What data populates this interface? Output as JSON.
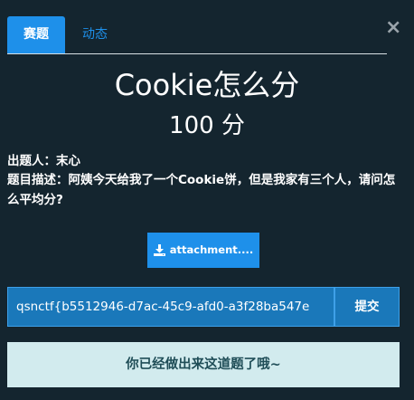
{
  "tabs": [
    {
      "label": "赛题",
      "active": true
    },
    {
      "label": "动态",
      "active": false
    }
  ],
  "close_icon": "close-icon",
  "challenge": {
    "title": "Cookie怎么分",
    "score": "100 分",
    "author_label": "出题人：",
    "author_name": "末心",
    "description_label": "题目描述：",
    "description": "阿姨今天给我了一个Cookie饼，但是我家有三个人，请问怎么平均分?"
  },
  "attachment": {
    "icon": "download-icon",
    "label": "attachment...."
  },
  "flag": {
    "value": "qsnctf{b5512946-d7ac-45c9-afd0-a3f28ba547e",
    "submit_label": "提交"
  },
  "status": {
    "message": "你已经做出来这道题了哦~"
  },
  "colors": {
    "background": "#14252f",
    "accent": "#1e90ea",
    "input_bg": "#1a78ba",
    "solved_bg": "#d2ebee",
    "solved_text": "#1f4d57"
  }
}
